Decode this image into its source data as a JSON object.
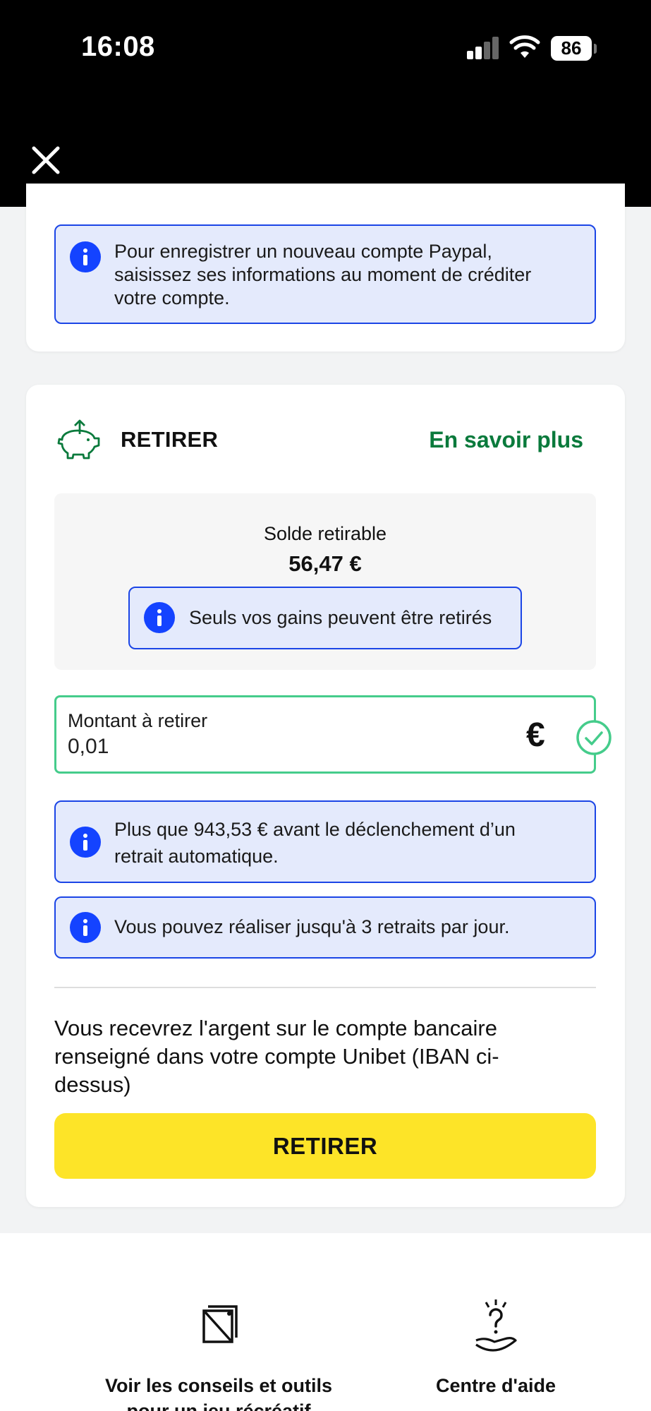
{
  "status_bar": {
    "time": "16:08",
    "battery": "86",
    "icons": [
      "signal-icon",
      "wifi-icon",
      "battery-icon"
    ]
  },
  "header": {
    "close_icon": "close-icon"
  },
  "paypal_info": {
    "text_lines": [
      "Pour enregistrer un nouveau compte Paypal,",
      "saisissez ses informations au moment de créditer",
      "votre compte."
    ]
  },
  "withdraw": {
    "title": "RETIRER",
    "learn_more": "En savoir plus",
    "balance_label": "Solde retirable",
    "balance_value": "56,47 €",
    "balance_info": "Seuls vos gains peuvent être retirés",
    "amount_label": "Montant à retirer",
    "amount_value": "0,01",
    "currency": "€",
    "auto_withdraw_lines": [
      "Plus que 943,53 € avant le déclenchement d’un",
      "retrait automatique."
    ],
    "limit_info": "Vous pouvez réaliser jusqu'à 3 retraits par jour.",
    "notice_lines": [
      "Vous recevrez l'argent sur le compte bancaire",
      "renseigné dans votre compte Unibet (IBAN ci-",
      "dessus)"
    ],
    "button_label": "RETIRER"
  },
  "footer": {
    "tools_lines": [
      "Voir les conseils et outils",
      "pour un jeu récréatif"
    ],
    "help_label": "Centre d'aide"
  },
  "colors": {
    "accent_green": "#0a7a3c",
    "info_blue": "#1443ff",
    "info_bg": "#e4eafc",
    "button_yellow": "#fde428",
    "field_border": "#45cc8b"
  }
}
